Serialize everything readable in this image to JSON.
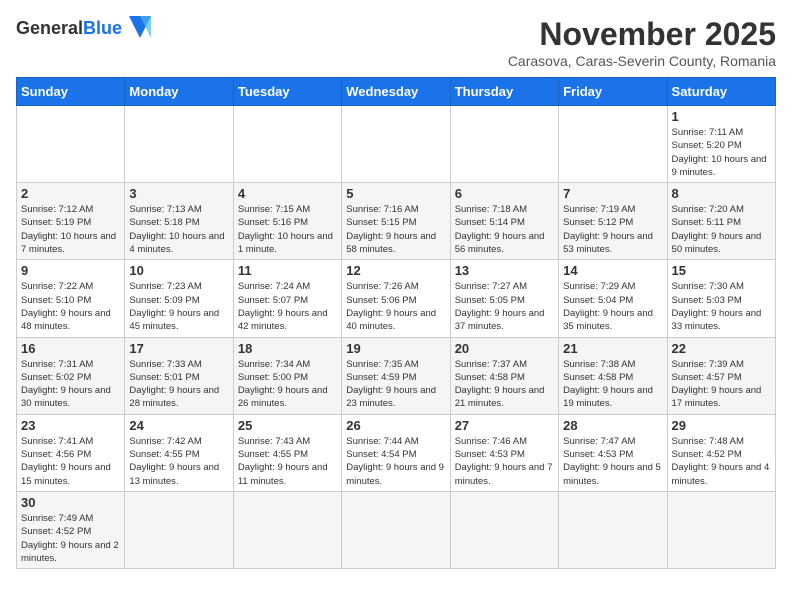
{
  "header": {
    "logo_general": "General",
    "logo_blue": "Blue",
    "month_title": "November 2025",
    "location": "Carasova, Caras-Severin County, Romania"
  },
  "weekdays": [
    "Sunday",
    "Monday",
    "Tuesday",
    "Wednesday",
    "Thursday",
    "Friday",
    "Saturday"
  ],
  "weeks": [
    [
      {
        "day": "",
        "info": ""
      },
      {
        "day": "",
        "info": ""
      },
      {
        "day": "",
        "info": ""
      },
      {
        "day": "",
        "info": ""
      },
      {
        "day": "",
        "info": ""
      },
      {
        "day": "",
        "info": ""
      },
      {
        "day": "1",
        "info": "Sunrise: 7:11 AM\nSunset: 5:20 PM\nDaylight: 10 hours and 9 minutes."
      }
    ],
    [
      {
        "day": "2",
        "info": "Sunrise: 7:12 AM\nSunset: 5:19 PM\nDaylight: 10 hours and 7 minutes."
      },
      {
        "day": "3",
        "info": "Sunrise: 7:13 AM\nSunset: 5:18 PM\nDaylight: 10 hours and 4 minutes."
      },
      {
        "day": "4",
        "info": "Sunrise: 7:15 AM\nSunset: 5:16 PM\nDaylight: 10 hours and 1 minute."
      },
      {
        "day": "5",
        "info": "Sunrise: 7:16 AM\nSunset: 5:15 PM\nDaylight: 9 hours and 58 minutes."
      },
      {
        "day": "6",
        "info": "Sunrise: 7:18 AM\nSunset: 5:14 PM\nDaylight: 9 hours and 56 minutes."
      },
      {
        "day": "7",
        "info": "Sunrise: 7:19 AM\nSunset: 5:12 PM\nDaylight: 9 hours and 53 minutes."
      },
      {
        "day": "8",
        "info": "Sunrise: 7:20 AM\nSunset: 5:11 PM\nDaylight: 9 hours and 50 minutes."
      }
    ],
    [
      {
        "day": "9",
        "info": "Sunrise: 7:22 AM\nSunset: 5:10 PM\nDaylight: 9 hours and 48 minutes."
      },
      {
        "day": "10",
        "info": "Sunrise: 7:23 AM\nSunset: 5:09 PM\nDaylight: 9 hours and 45 minutes."
      },
      {
        "day": "11",
        "info": "Sunrise: 7:24 AM\nSunset: 5:07 PM\nDaylight: 9 hours and 42 minutes."
      },
      {
        "day": "12",
        "info": "Sunrise: 7:26 AM\nSunset: 5:06 PM\nDaylight: 9 hours and 40 minutes."
      },
      {
        "day": "13",
        "info": "Sunrise: 7:27 AM\nSunset: 5:05 PM\nDaylight: 9 hours and 37 minutes."
      },
      {
        "day": "14",
        "info": "Sunrise: 7:29 AM\nSunset: 5:04 PM\nDaylight: 9 hours and 35 minutes."
      },
      {
        "day": "15",
        "info": "Sunrise: 7:30 AM\nSunset: 5:03 PM\nDaylight: 9 hours and 33 minutes."
      }
    ],
    [
      {
        "day": "16",
        "info": "Sunrise: 7:31 AM\nSunset: 5:02 PM\nDaylight: 9 hours and 30 minutes."
      },
      {
        "day": "17",
        "info": "Sunrise: 7:33 AM\nSunset: 5:01 PM\nDaylight: 9 hours and 28 minutes."
      },
      {
        "day": "18",
        "info": "Sunrise: 7:34 AM\nSunset: 5:00 PM\nDaylight: 9 hours and 26 minutes."
      },
      {
        "day": "19",
        "info": "Sunrise: 7:35 AM\nSunset: 4:59 PM\nDaylight: 9 hours and 23 minutes."
      },
      {
        "day": "20",
        "info": "Sunrise: 7:37 AM\nSunset: 4:58 PM\nDaylight: 9 hours and 21 minutes."
      },
      {
        "day": "21",
        "info": "Sunrise: 7:38 AM\nSunset: 4:58 PM\nDaylight: 9 hours and 19 minutes."
      },
      {
        "day": "22",
        "info": "Sunrise: 7:39 AM\nSunset: 4:57 PM\nDaylight: 9 hours and 17 minutes."
      }
    ],
    [
      {
        "day": "23",
        "info": "Sunrise: 7:41 AM\nSunset: 4:56 PM\nDaylight: 9 hours and 15 minutes."
      },
      {
        "day": "24",
        "info": "Sunrise: 7:42 AM\nSunset: 4:55 PM\nDaylight: 9 hours and 13 minutes."
      },
      {
        "day": "25",
        "info": "Sunrise: 7:43 AM\nSunset: 4:55 PM\nDaylight: 9 hours and 11 minutes."
      },
      {
        "day": "26",
        "info": "Sunrise: 7:44 AM\nSunset: 4:54 PM\nDaylight: 9 hours and 9 minutes."
      },
      {
        "day": "27",
        "info": "Sunrise: 7:46 AM\nSunset: 4:53 PM\nDaylight: 9 hours and 7 minutes."
      },
      {
        "day": "28",
        "info": "Sunrise: 7:47 AM\nSunset: 4:53 PM\nDaylight: 9 hours and 5 minutes."
      },
      {
        "day": "29",
        "info": "Sunrise: 7:48 AM\nSunset: 4:52 PM\nDaylight: 9 hours and 4 minutes."
      }
    ],
    [
      {
        "day": "30",
        "info": "Sunrise: 7:49 AM\nSunset: 4:52 PM\nDaylight: 9 hours and 2 minutes."
      },
      {
        "day": "",
        "info": ""
      },
      {
        "day": "",
        "info": ""
      },
      {
        "day": "",
        "info": ""
      },
      {
        "day": "",
        "info": ""
      },
      {
        "day": "",
        "info": ""
      },
      {
        "day": "",
        "info": ""
      }
    ]
  ]
}
